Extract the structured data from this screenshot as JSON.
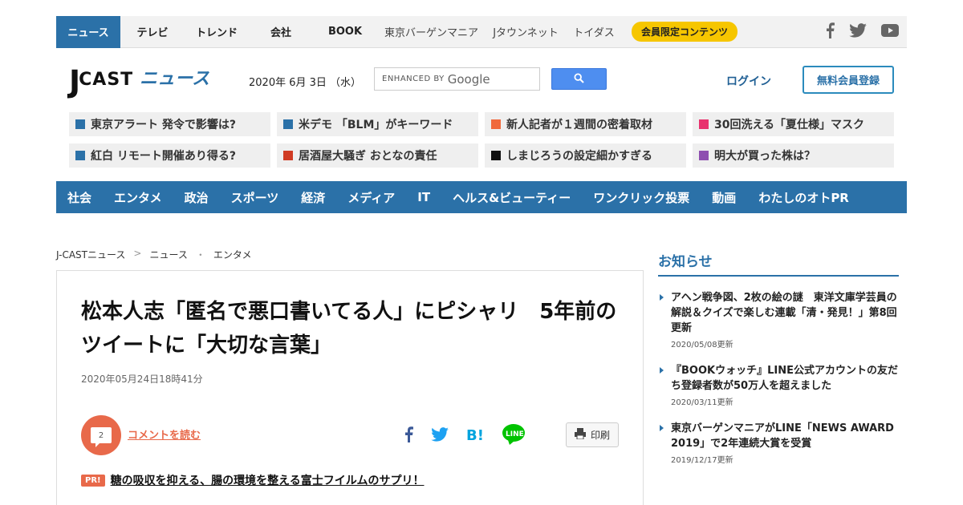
{
  "topbar": {
    "items": [
      "ニュース",
      "テレビ",
      "トレンド",
      "会社",
      "BOOK",
      "東京バーゲンマニア",
      "Jタウンネット",
      "トイダス"
    ],
    "members_label": "会員限定コンテンツ"
  },
  "header": {
    "logo_j": "J",
    "logo_cast": "CAST",
    "logo_news": "ニュース",
    "date": "2020年 6月 3日 （水）",
    "search_enhanced": "ENHANCED BY",
    "search_google": "Google",
    "login": "ログイン",
    "register": "無料会員登録"
  },
  "trending": [
    {
      "label": "東京アラート 発令で影響は?",
      "color": "#2b71a8"
    },
    {
      "label": "米デモ 「BLM」がキーワード",
      "color": "#2b71a8"
    },
    {
      "label": "新人記者が１週間の密着取材",
      "color": "#f0693c"
    },
    {
      "label": "30回洗える「夏仕様」マスク",
      "color": "#e8326e"
    },
    {
      "label": "紅白 リモート開催あり得る?",
      "color": "#2b71a8"
    },
    {
      "label": "居酒屋大騒ぎ おとなの責任",
      "color": "#d03a22"
    },
    {
      "label": "しまじろうの設定細かすぎる",
      "color": "#111111"
    },
    {
      "label": "明大が買った株は？",
      "color": "#8e4fb0"
    }
  ],
  "categories": [
    "社会",
    "エンタメ",
    "政治",
    "スポーツ",
    "経済",
    "メディア",
    "IT",
    "ヘルス&ビューティー",
    "ワンクリック投票",
    "動画",
    "わたしのオトPR"
  ],
  "breadcrumb": [
    "J-CASTニュース",
    "ニュース",
    "エンタメ"
  ],
  "article": {
    "title": "松本人志「匿名で悪口書いてる人」にピシャリ　5年前のツイートに「大切な言葉」",
    "published": "2020年05月24日18時41分",
    "comment_count": "2",
    "comment_link": "コメントを読む",
    "print_label": "印刷",
    "pr_tag": "PR!",
    "pr_link": "糖の吸収を抑える、腸の環境を整える富士フイルムのサプリ！"
  },
  "sidebar": {
    "title": "お知らせ",
    "notices": [
      {
        "text": "アヘン戦争図、2枚の絵の謎　東洋文庫学芸員の解説＆クイズで楽しむ連載「清・発見！」第8回更新",
        "date": "2020/05/08更新"
      },
      {
        "text": "『BOOKウォッチ』LINE公式アカウントの友だち登録者数が50万人を超えました",
        "date": "2020/03/11更新"
      },
      {
        "text": "東京バーゲンマニアがLINE「NEWS AWARD 2019」で2年連続大賞を受賞",
        "date": "2019/12/17更新"
      }
    ]
  },
  "colors": {
    "brand": "#2b71a8",
    "accent": "#e8694a",
    "members": "#f6c600"
  }
}
